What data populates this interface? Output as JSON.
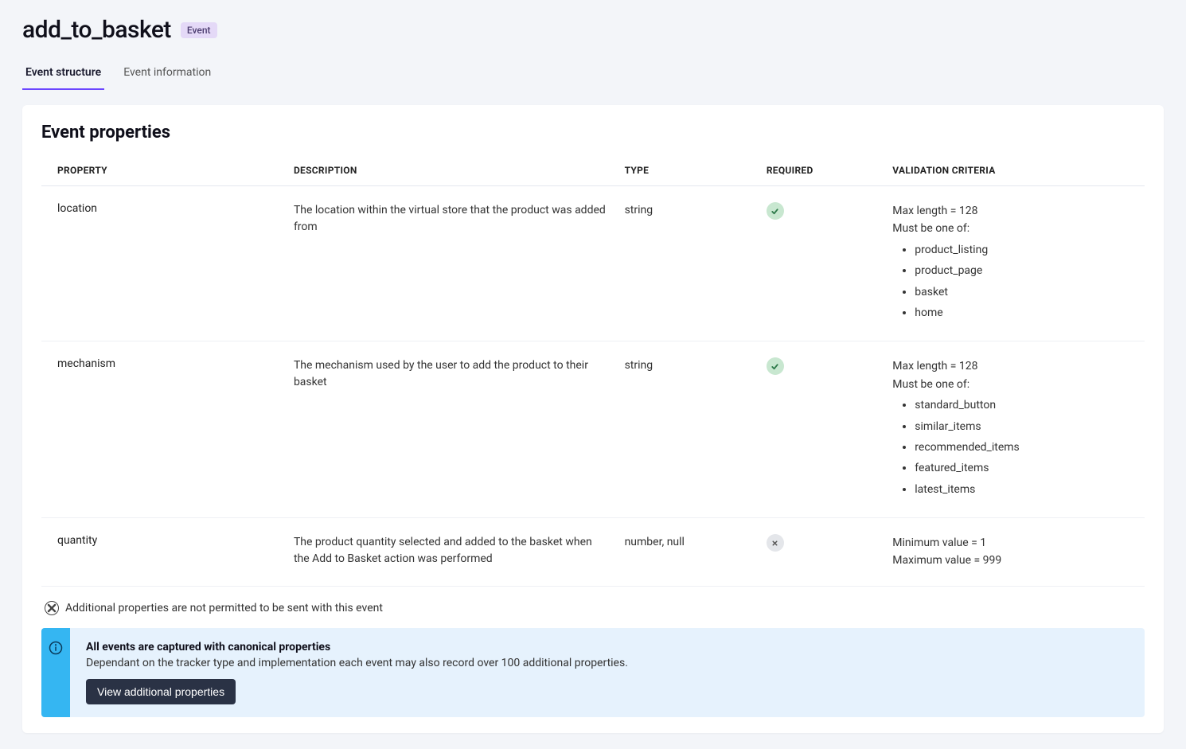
{
  "header": {
    "title": "add_to_basket",
    "badge": "Event"
  },
  "tabs": [
    {
      "label": "Event structure",
      "active": true
    },
    {
      "label": "Event information",
      "active": false
    }
  ],
  "section_title": "Event properties",
  "columns": {
    "property": "PROPERTY",
    "description": "DESCRIPTION",
    "type": "TYPE",
    "required": "REQUIRED",
    "validation": "VALIDATION CRITERIA"
  },
  "rows": [
    {
      "property": "location",
      "description": "The location within the virtual store that the product was added from",
      "type": "string",
      "required": true,
      "validation_lines": [
        "Max length = 128",
        "Must be one of:"
      ],
      "validation_list": [
        "product_listing",
        "product_page",
        "basket",
        "home"
      ]
    },
    {
      "property": "mechanism",
      "description": "The mechanism used by the user to add the product to their basket",
      "type": "string",
      "required": true,
      "validation_lines": [
        "Max length = 128",
        "Must be one of:"
      ],
      "validation_list": [
        "standard_button",
        "similar_items",
        "recommended_items",
        "featured_items",
        "latest_items"
      ]
    },
    {
      "property": "quantity",
      "description": "The product quantity selected and added to the basket when the Add to Basket action was performed",
      "type": "number, null",
      "required": false,
      "validation_lines": [
        "Minimum value = 1",
        "Maximum value = 999"
      ],
      "validation_list": []
    }
  ],
  "additional_note": "Additional properties are not permitted to be sent with this event",
  "info": {
    "title": "All events are captured with canonical properties",
    "text": "Dependant on the tracker type and implementation each event may also record over 100 additional properties.",
    "button": "View additional properties"
  }
}
